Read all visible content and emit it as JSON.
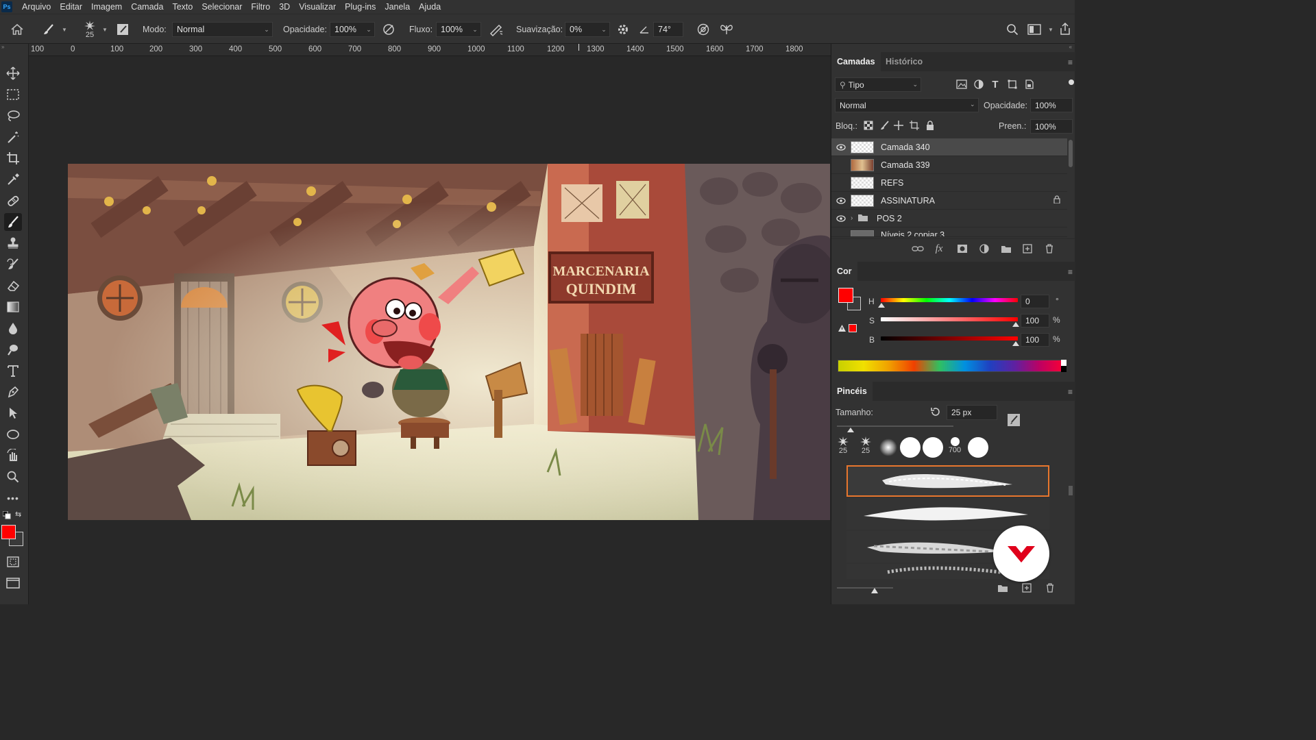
{
  "app": {
    "logo_text": "Ps"
  },
  "menubar": {
    "items": [
      "Arquivo",
      "Editar",
      "Imagem",
      "Camada",
      "Texto",
      "Selecionar",
      "Filtro",
      "3D",
      "Visualizar",
      "Plug-ins",
      "Janela",
      "Ajuda"
    ]
  },
  "options": {
    "brush_size": "25",
    "mode_label": "Modo:",
    "mode_value": "Normal",
    "opacity_label": "Opacidade:",
    "opacity_value": "100%",
    "flow_label": "Fluxo:",
    "flow_value": "100%",
    "smoothing_label": "Suavização:",
    "smoothing_value": "0%",
    "angle_value": "74°"
  },
  "ruler": {
    "labels": [
      "100",
      "0",
      "100",
      "200",
      "300",
      "400",
      "500",
      "600",
      "700",
      "800",
      "900",
      "1000",
      "1100",
      "1200",
      "1300",
      "1400",
      "1500",
      "1600",
      "1700",
      "1800"
    ]
  },
  "artwork": {
    "sign_line1": "MARCENARIA",
    "sign_line2": "QUINDIM"
  },
  "layers_panel": {
    "tabs": [
      "Camadas",
      "Histórico"
    ],
    "filter_label": "Tipo",
    "blend_mode": "Normal",
    "opacity_label": "Opacidade:",
    "opacity_value": "100%",
    "lock_label": "Bloq.:",
    "fill_label": "Preen.:",
    "fill_value": "100%",
    "layers": [
      {
        "name": "Camada 340",
        "visible": true,
        "selected": true
      },
      {
        "name": "Camada 339",
        "visible": false,
        "selected": false
      },
      {
        "name": "REFS",
        "visible": false,
        "selected": false
      },
      {
        "name": "ASSINATURA",
        "visible": true,
        "selected": false,
        "locked": true
      },
      {
        "name": "POS 2",
        "visible": true,
        "selected": false,
        "group": true
      },
      {
        "name": "Níveis 2 copiar 3",
        "visible": false,
        "selected": false
      }
    ]
  },
  "color_panel": {
    "title": "Cor",
    "foreground": "#ff0000",
    "h_label": "H",
    "h_value": "0",
    "h_unit": "°",
    "s_label": "S",
    "s_value": "100",
    "s_unit": "%",
    "b_label": "B",
    "b_value": "100",
    "b_unit": "%"
  },
  "brushes_panel": {
    "title": "Pincéis",
    "size_label": "Tamanho:",
    "size_value": "25 px",
    "presets": [
      "25",
      "25",
      "",
      "",
      "",
      "700",
      ""
    ]
  },
  "colors": {
    "accent": "#e8762d",
    "fab_icon": "#e0001b"
  }
}
